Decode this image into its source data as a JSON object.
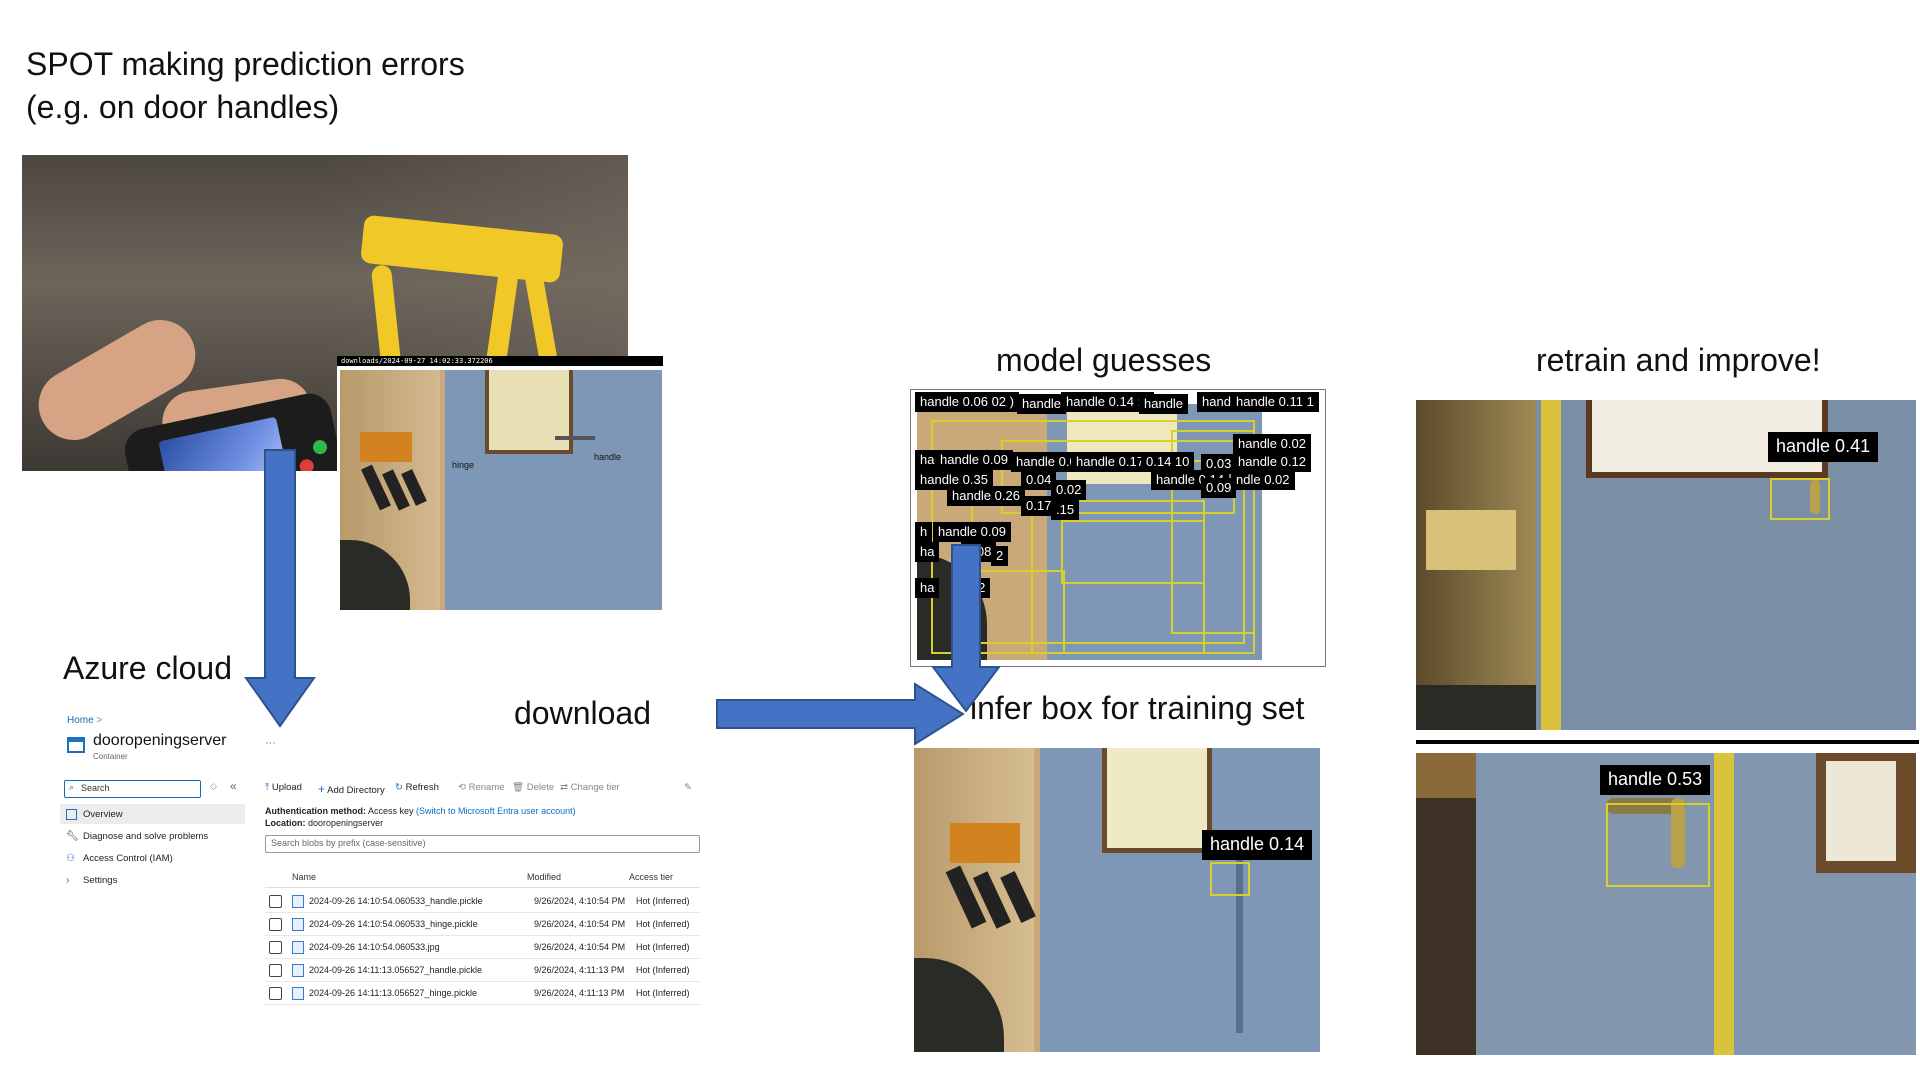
{
  "title_line1": "SPOT making prediction errors",
  "title_line2": "(e.g. on door handles)",
  "download_path": "downloads/2024-09-27 14:02:33.372206",
  "label_hinge": "hinge",
  "label_handle": "handle",
  "heading_azure": "Azure cloud",
  "heading_download": "download",
  "heading_model": "model guesses",
  "heading_infer": "infer box for training set",
  "heading_retrain": "retrain and improve!",
  "model_guess_labels": [
    "handle 0.06 02 )",
    "handle",
    "handle 0.14 : (",
    "handle",
    "hand",
    "handle 0.11 1",
    "har",
    "handle 0.09",
    "handle 0.0",
    "handle 0.17",
    "0.14 10",
    "0.03",
    "handle 0.02",
    "handle 0.12",
    "handle 0.35",
    "0.04",
    "handle 0.14",
    "ndle 0.02",
    "handle 0.26",
    "0.02",
    "0.09",
    "0.17",
    ".15",
    "h",
    "handle 0.09",
    "ha",
    "0.08",
    "2",
    "ha",
    "0.02"
  ],
  "infer_label": "handle 0.14",
  "retrain_label_1": "handle 0.41",
  "retrain_label_2": "handle 0.53",
  "azure": {
    "breadcrumb": "Home",
    "container_name": "dooropeningserver",
    "container_type": "Container",
    "more": "···",
    "search_placeholder": "Search",
    "collapse": "«",
    "nav": [
      "Overview",
      "Diagnose and solve problems",
      "Access Control (IAM)",
      "Settings"
    ],
    "toolbar": [
      "Upload",
      "Add Directory",
      "Refresh",
      "Rename",
      "Delete",
      "Change tier"
    ],
    "auth_label": "Authentication method:",
    "auth_value": "Access key",
    "auth_link": "(Switch to Microsoft Entra user account)",
    "location_label": "Location:",
    "location_value": "dooropeningserver",
    "blob_search_placeholder": "Search blobs by prefix (case-sensitive)",
    "columns": [
      "Name",
      "Modified",
      "Access tier"
    ],
    "rows": [
      {
        "name": "2024-09-26 14:10:54.060533_handle.pickle",
        "modified": "9/26/2024, 4:10:54 PM",
        "tier": "Hot (Inferred)"
      },
      {
        "name": "2024-09-26 14:10:54.060533_hinge.pickle",
        "modified": "9/26/2024, 4:10:54 PM",
        "tier": "Hot (Inferred)"
      },
      {
        "name": "2024-09-26 14:10:54.060533.jpg",
        "modified": "9/26/2024, 4:10:54 PM",
        "tier": "Hot (Inferred)"
      },
      {
        "name": "2024-09-26 14:11:13.056527_handle.pickle",
        "modified": "9/26/2024, 4:11:13 PM",
        "tier": "Hot (Inferred)"
      },
      {
        "name": "2024-09-26 14:11:13.056527_hinge.pickle",
        "modified": "9/26/2024, 4:11:13 PM",
        "tier": "Hot (Inferred)"
      }
    ]
  },
  "colors": {
    "arrow": "#4472c4",
    "detection_box": "#d8d02a",
    "wall": "#7f97b6",
    "azure_link": "#0f6cbd"
  }
}
